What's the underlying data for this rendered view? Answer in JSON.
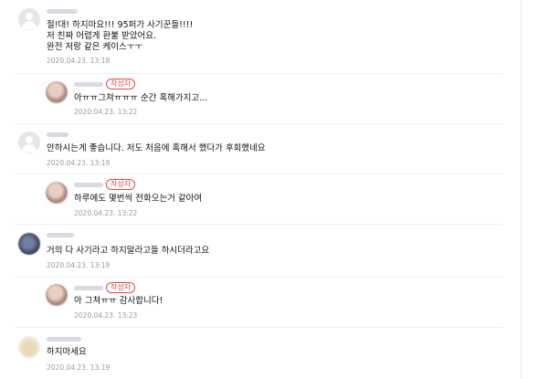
{
  "comments": [
    {
      "type": "comment",
      "text": "절!대! 하지마요!!! 95퍼가 사기꾼들!!!!\n저 친짜 어렵게 환불 받았어요.\n완전 저랑 같은 케이스ㅜㅜ",
      "date": "2020.04.23. 13:18"
    },
    {
      "type": "reply",
      "badge": "작성자",
      "text": "아ㅠㅠ그쳐ㅠㅠㅠ 순간 혹해가지고...",
      "date": "2020.04.23. 13:22"
    },
    {
      "type": "comment",
      "text": "안하시는게 좋습니다. 저도 처음에 혹해서 했다가 후회했네요",
      "date": "2020.04.23. 13:19"
    },
    {
      "type": "reply",
      "badge": "작성자",
      "text": "하루에도 몇번씩 전화오는거 같아여",
      "date": "2020.04.23. 13:22"
    },
    {
      "type": "comment",
      "text": "거의 다 사기라고 하지말라고들 하시더라고요",
      "date": "2020.04.23. 13:19"
    },
    {
      "type": "reply",
      "badge": "작성자",
      "text": "아 그쳐ㅠㅠ 감사합니다!",
      "date": "2020.04.23. 13:23"
    },
    {
      "type": "comment",
      "text": "하지마세요",
      "date": "2020.04.23. 13:19"
    }
  ]
}
